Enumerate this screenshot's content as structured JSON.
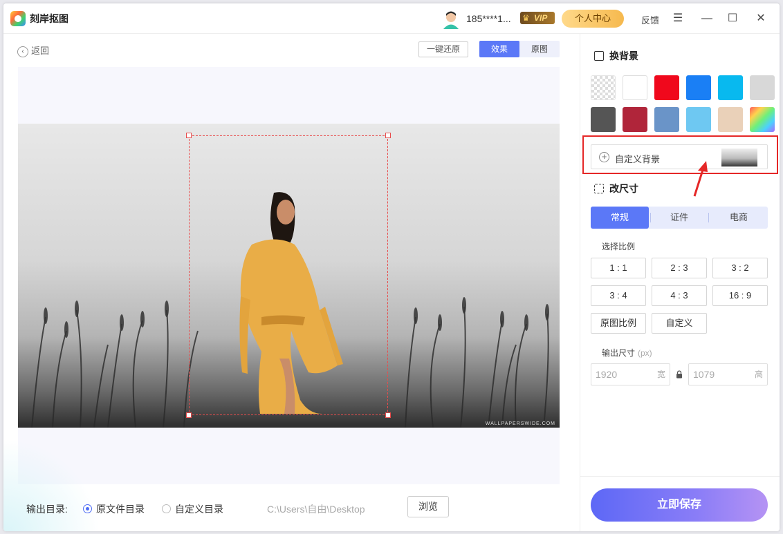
{
  "app": {
    "title": "刻岸抠图"
  },
  "header": {
    "username": "185****1...",
    "vip_badge": "VIP",
    "user_center": "个人中心",
    "feedback": "反馈",
    "menu_icon": "menu-icon",
    "minimize_icon": "minimize-icon",
    "maximize_icon": "maximize-icon",
    "close_icon": "close-icon"
  },
  "toolbar": {
    "back_label": "返回",
    "restore_label": "一键还原",
    "view_effect": "效果",
    "view_original": "原图"
  },
  "canvas": {
    "watermark": "WALLPAPERSWIDE.COM"
  },
  "background_section": {
    "title": "换背景",
    "swatches": [
      {
        "name": "transparent",
        "color": "transparent"
      },
      {
        "name": "white",
        "color": "#ffffff"
      },
      {
        "name": "red",
        "color": "#f0081c"
      },
      {
        "name": "blue",
        "color": "#1a7ff5"
      },
      {
        "name": "cyan",
        "color": "#08b9ef"
      },
      {
        "name": "light-gray",
        "color": "#d8d8d8"
      },
      {
        "name": "dark-gray",
        "color": "#555555"
      },
      {
        "name": "crimson",
        "color": "#b0253a"
      },
      {
        "name": "steel-blue",
        "color": "#6a94c8"
      },
      {
        "name": "sky-blue",
        "color": "#6ec8f2"
      },
      {
        "name": "beige",
        "color": "#ead1b9"
      },
      {
        "name": "rainbow",
        "color": "gradient"
      }
    ],
    "custom_label": "自定义背景"
  },
  "resize_section": {
    "title": "改尺寸",
    "tabs": [
      "常规",
      "证件",
      "电商"
    ],
    "active_tab": "常规",
    "ratio_label": "选择比例",
    "ratios": [
      "1 : 1",
      "2 : 3",
      "3 : 2",
      "3 : 4",
      "4 : 3",
      "16 : 9",
      "原图比例",
      "自定义"
    ],
    "output_size_label": "输出尺寸",
    "output_size_unit": "(px)",
    "width_value": "1920",
    "width_suffix": "宽",
    "height_value": "1079",
    "height_suffix": "高"
  },
  "output": {
    "label": "输出目录:",
    "option_original": "原文件目录",
    "option_custom": "自定义目录",
    "selected": "原文件目录",
    "path": "C:\\Users\\自由\\Desktop",
    "browse": "浏览"
  },
  "save_button": "立即保存",
  "colors": {
    "accent": "#5b78f7",
    "highlight": "#e52727",
    "crop": "#e84c4c"
  }
}
